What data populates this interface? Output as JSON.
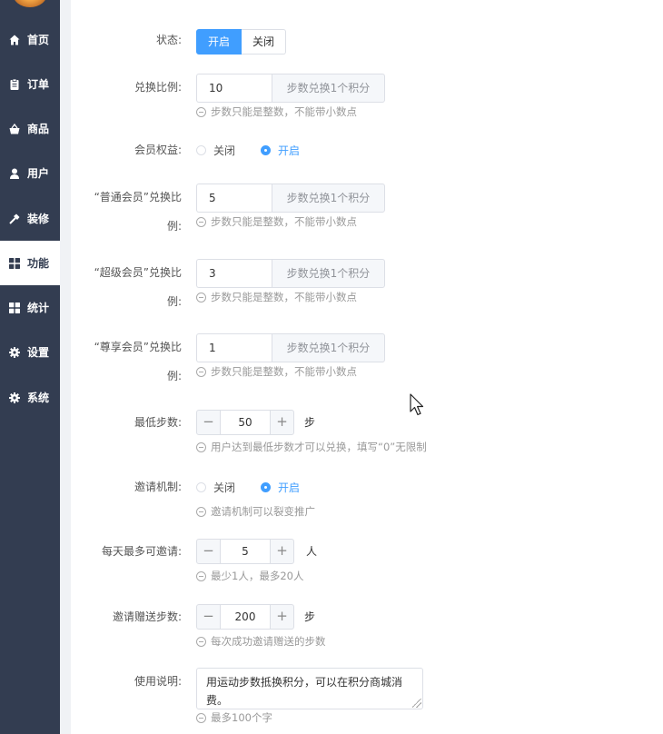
{
  "sidebar": {
    "items": [
      {
        "label": "首页",
        "icon": "home-icon"
      },
      {
        "label": "订单",
        "icon": "clipboard-icon"
      },
      {
        "label": "商品",
        "icon": "basket-icon"
      },
      {
        "label": "用户",
        "icon": "user-icon"
      },
      {
        "label": "装修",
        "icon": "hammer-icon"
      },
      {
        "label": "功能",
        "icon": "grid-icon"
      },
      {
        "label": "统计",
        "icon": "grid-icon"
      },
      {
        "label": "设置",
        "icon": "gear-icon"
      },
      {
        "label": "系统",
        "icon": "gear-icon"
      }
    ],
    "active_index": 5,
    "bg_color": "#333d51"
  },
  "form": {
    "status": {
      "label": "状态:",
      "on": "开启",
      "off": "关闭",
      "selected": "开启"
    },
    "ratio": {
      "label": "兑换比例:",
      "value": "10",
      "suffix": "步数兑换1个积分",
      "hint": "步数只能是整数，不能带小数点"
    },
    "member_rights": {
      "label": "会员权益:",
      "options": [
        "关闭",
        "开启"
      ],
      "selected": "开启"
    },
    "normal_ratio": {
      "label_line1": "“普通会员”兑换比",
      "label_line2": "例:",
      "value": "5",
      "suffix": "步数兑换1个积分",
      "hint": "步数只能是整数，不能带小数点"
    },
    "super_ratio": {
      "label_line1": "“超级会员”兑换比",
      "label_line2": "例:",
      "value": "3",
      "suffix": "步数兑换1个积分",
      "hint": "步数只能是整数，不能带小数点"
    },
    "vip_ratio": {
      "label_line1": "“尊享会员”兑换比",
      "label_line2": "例:",
      "value": "1",
      "suffix": "步数兑换1个积分",
      "hint": "步数只能是整数，不能带小数点"
    },
    "min_steps": {
      "label": "最低步数:",
      "value": "50",
      "unit": "步",
      "hint": "用户达到最低步数才可以兑换，填写“0”无限制"
    },
    "invite": {
      "label": "邀请机制:",
      "options": [
        "关闭",
        "开启"
      ],
      "selected": "开启",
      "hint": "邀请机制可以裂变推广"
    },
    "daily_invite": {
      "label": "每天最多可邀请:",
      "value": "5",
      "unit": "人",
      "hint": "最少1人，最多20人"
    },
    "invite_steps": {
      "label": "邀请赠送步数:",
      "value": "200",
      "unit": "步",
      "hint": "每次成功邀请赠送的步数"
    },
    "usage": {
      "label": "使用说明:",
      "value": "用运动步数抵换积分，可以在积分商城消费。",
      "hint": "最多100个字"
    }
  },
  "colors": {
    "accent": "#409eff",
    "border": "#dcdfe6",
    "hint": "#999999"
  }
}
